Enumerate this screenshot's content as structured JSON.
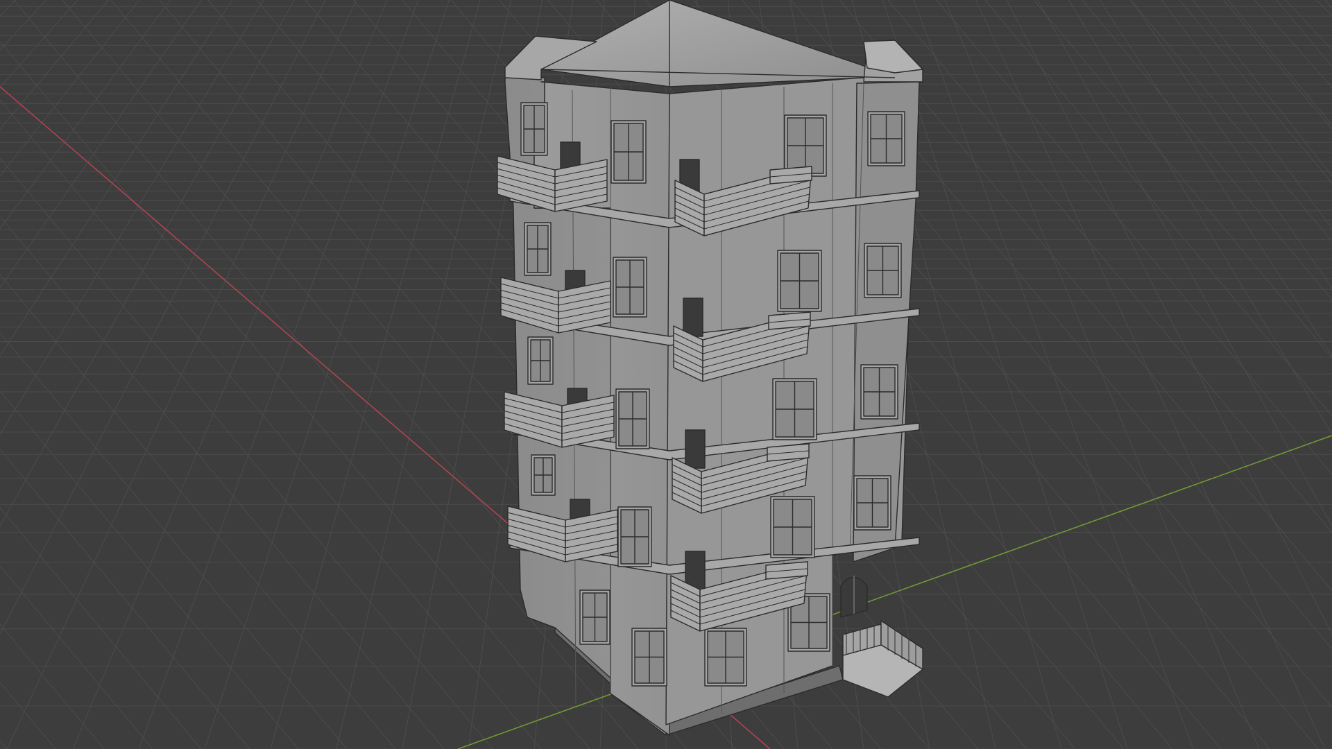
{
  "viewport": {
    "editor": "3D Viewport",
    "shading": "solid",
    "background_color": "#3d3d3d",
    "grid_color": "#4f4f4f",
    "x_axis_color": "#c0464f",
    "y_axis_color": "#76a839",
    "model_color": "#9a9a9a",
    "edge_color": "#2a2a2a"
  },
  "model": {
    "object": "apartment-building",
    "floors": 5,
    "balconies_per_floor": 2
  }
}
